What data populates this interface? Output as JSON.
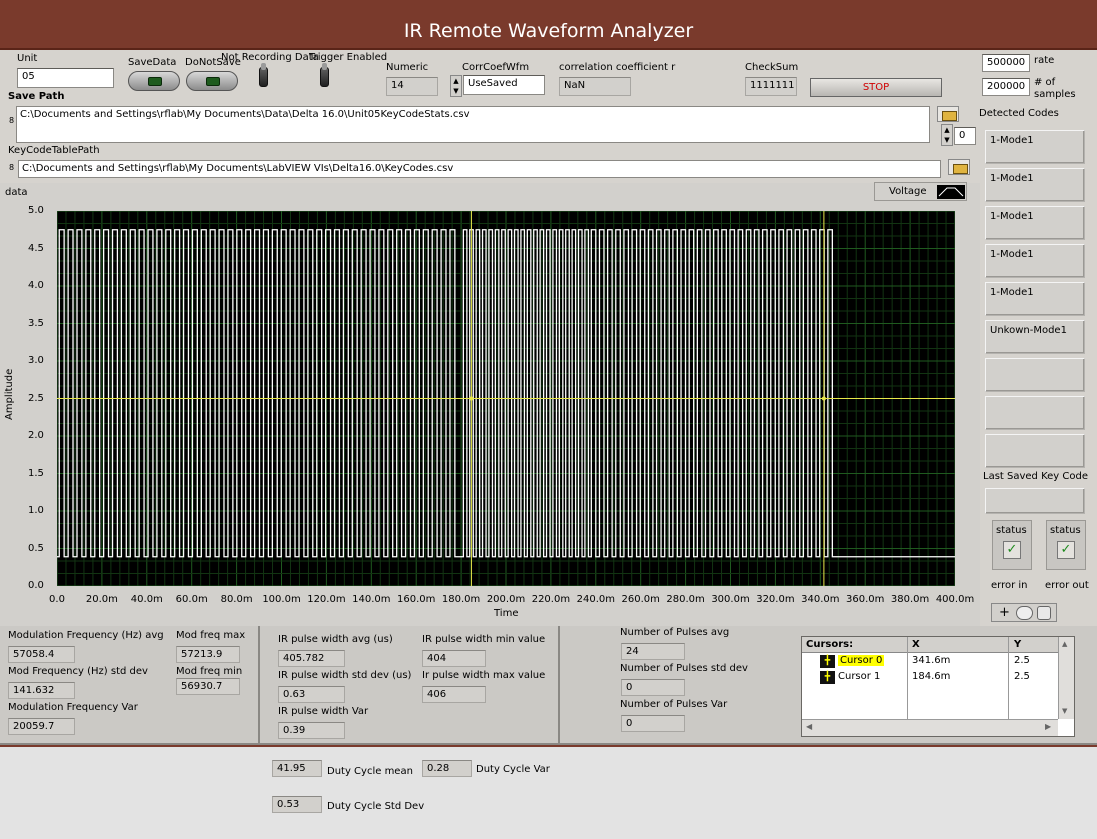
{
  "window": {
    "title": "IR Remote Waveform Analyzer"
  },
  "top": {
    "unit_label": "Unit",
    "unit_value": "05",
    "save_data_label": "SaveData",
    "do_not_save_label": "DoNotSave",
    "not_recording_label": "Not Recording Data",
    "trigger_enabled_label": "Trigger Enabled",
    "numeric_label": "Numeric",
    "numeric_value": "14",
    "corr_wfm_label": "CorrCoefWfm",
    "corr_wfm_value": "UseSaved",
    "corr_coef_label": "correlation coefficient r",
    "corr_coef_value": "NaN",
    "checksum_label": "CheckSum",
    "checksum_value": "1111111",
    "stop_label": "STOP",
    "rate_value": "500000",
    "rate_label": "rate",
    "samples_value": "200000",
    "samples_label_1": "# of",
    "samples_label_2": "samples",
    "save_path_label": "Save Path",
    "save_path_value": "C:\\Documents and Settings\\rflab\\My Documents\\Data\\Delta 16.0\\Unit05KeyCodeStats.csv",
    "keycode_path_label": "KeyCodeTablePath",
    "keycode_path_value": "C:\\Documents and Settings\\rflab\\My Documents\\LabVIEW VIs\\Delta16.0\\KeyCodes.csv",
    "index_value": "0",
    "path_prefix_glyph": "8"
  },
  "right_panel": {
    "detected_label": "Detected Codes",
    "codes": [
      "1-Mode1",
      "1-Mode1",
      "1-Mode1",
      "1-Mode1",
      "1-Mode1",
      "Unkown-Mode1",
      "",
      "",
      ""
    ],
    "last_saved_label": "Last Saved Key Code",
    "last_saved_value": "",
    "status_label": "status",
    "error_in_label": "error in",
    "error_out_label": "error out",
    "check_glyph": "✓"
  },
  "graph": {
    "title": "data",
    "legend_label": "Voltage",
    "xlabel": "Time",
    "ylabel": "Amplitude",
    "colors": {
      "trace": "#ffffff",
      "grid_major": "#1f5a1f",
      "grid_minor": "#123412",
      "cursor": "#e8e84a"
    }
  },
  "chart_data": {
    "type": "line",
    "title": "",
    "xlabel": "Time",
    "ylabel": "Amplitude",
    "xlim": [
      0,
      0.4
    ],
    "ylim": [
      0,
      5
    ],
    "x_ticks": [
      "0.0",
      "20.0m",
      "40.0m",
      "60.0m",
      "80.0m",
      "100.0m",
      "120.0m",
      "140.0m",
      "160.0m",
      "180.0m",
      "200.0m",
      "220.0m",
      "240.0m",
      "260.0m",
      "280.0m",
      "300.0m",
      "320.0m",
      "340.0m",
      "360.0m",
      "380.0m",
      "400.0m"
    ],
    "y_ticks": [
      "0.0",
      "0.5",
      "1.0",
      "1.5",
      "2.0",
      "2.5",
      "3.0",
      "3.5",
      "4.0",
      "4.5",
      "5.0"
    ],
    "series": [
      {
        "name": "Voltage",
        "low": 0.39,
        "high": 4.75,
        "bursts": [
          {
            "start": 0.001,
            "end": 0.179,
            "pulses": 45
          },
          {
            "start": 0.181,
            "end": 0.238,
            "pulses": 20
          },
          {
            "start": 0.238,
            "end": 0.347,
            "pulses": 30
          }
        ],
        "end": 0.347
      }
    ],
    "cursors": [
      {
        "name": "Cursor 0",
        "x": 0.3416,
        "y": 2.5
      },
      {
        "name": "Cursor 1",
        "x": 0.1846,
        "y": 2.5
      }
    ],
    "grid": true
  },
  "stats": {
    "mod_freq_avg_label": "Modulation Frequency (Hz) avg",
    "mod_freq_avg": "57058.4",
    "mod_freq_std_label": "Mod Frequency (Hz) std dev",
    "mod_freq_std": "141.632",
    "mod_freq_var_label": "Modulation Frequency Var",
    "mod_freq_var": "20059.7",
    "mod_freq_max_label": "Mod freq max",
    "mod_freq_max": "57213.9",
    "mod_freq_min_label": "Mod freq min",
    "mod_freq_min": "56930.7",
    "ir_pw_avg_label": "IR pulse width avg (us)",
    "ir_pw_avg": "405.782",
    "ir_pw_std_label": "IR pulse width std dev (us)",
    "ir_pw_std": "0.63",
    "ir_pw_var_label": "IR pulse width Var",
    "ir_pw_var": "0.39",
    "ir_pw_min_label": "IR pulse width min value",
    "ir_pw_min": "404",
    "ir_pw_max_label": "Ir pulse width max value",
    "ir_pw_max": "406",
    "pulses_avg_label": "Number of Pulses avg",
    "pulses_avg": "24",
    "pulses_std_label": "Number of Pulses std dev",
    "pulses_std": "0",
    "pulses_var_label": "Number of Pulses Var",
    "pulses_var": "0"
  },
  "cursor_table": {
    "headers": [
      "Cursors:",
      "X",
      "Y"
    ],
    "rows": [
      {
        "name": "Cursor 0",
        "x": "341.6m",
        "y": "2.5"
      },
      {
        "name": "Cursor 1",
        "x": "184.6m",
        "y": "2.5"
      }
    ]
  },
  "duty": {
    "mean_value": "41.95",
    "mean_label": "Duty Cycle mean",
    "var_value": "0.28",
    "var_label": "Duty Cycle Var",
    "std_value": "0.53",
    "std_label": "Duty Cycle Std Dev"
  }
}
